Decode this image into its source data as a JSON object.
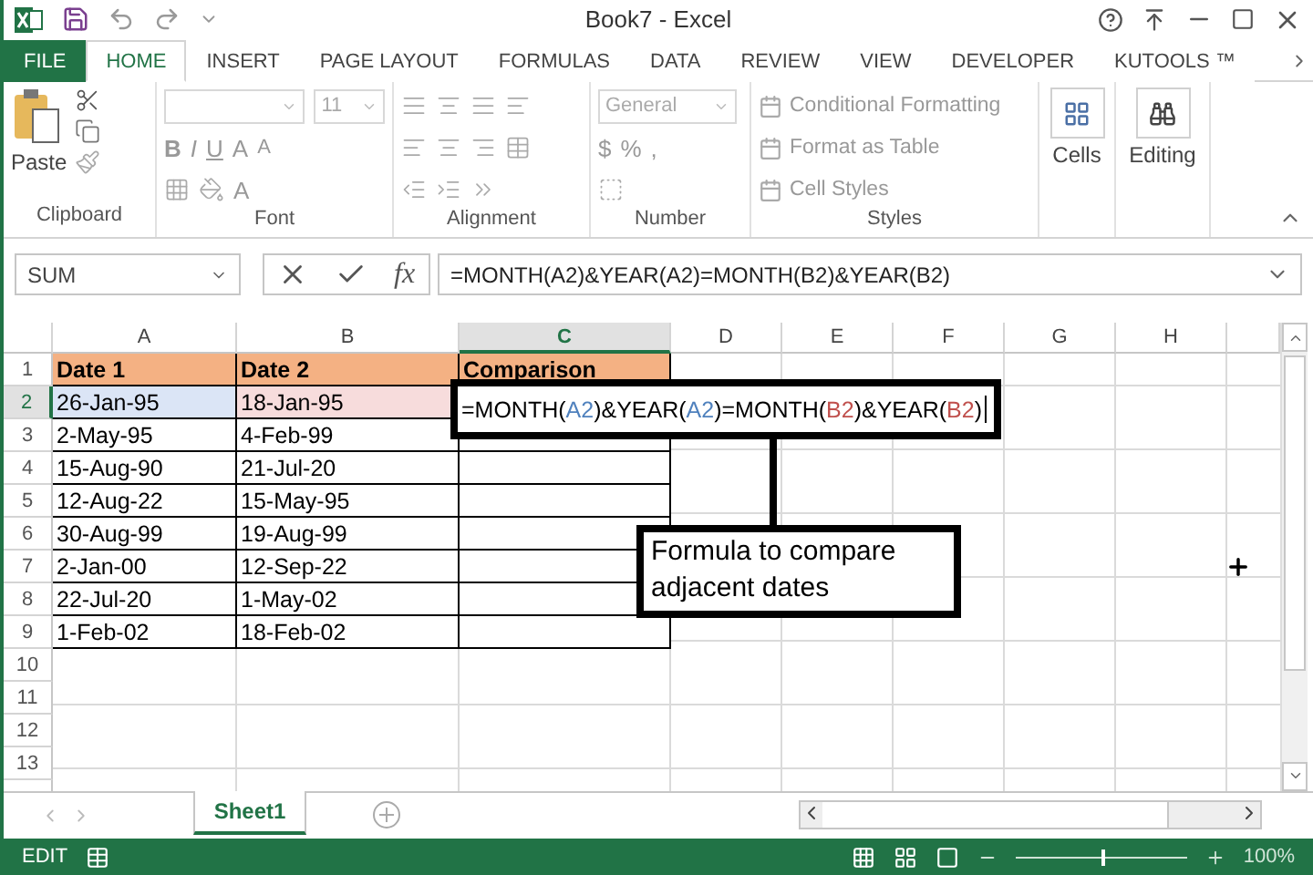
{
  "window": {
    "title": "Book7 - Excel"
  },
  "tabs": [
    {
      "label": "FILE",
      "kind": "file",
      "selected": false
    },
    {
      "label": "HOME",
      "kind": "tab",
      "selected": true
    },
    {
      "label": "INSERT",
      "kind": "tab",
      "selected": false
    },
    {
      "label": "PAGE LAYOUT",
      "kind": "tab",
      "selected": false
    },
    {
      "label": "FORMULAS",
      "kind": "tab",
      "selected": false
    },
    {
      "label": "DATA",
      "kind": "tab",
      "selected": false
    },
    {
      "label": "REVIEW",
      "kind": "tab",
      "selected": false
    },
    {
      "label": "VIEW",
      "kind": "tab",
      "selected": false
    },
    {
      "label": "DEVELOPER",
      "kind": "tab",
      "selected": false
    },
    {
      "label": "KUTOOLS ™",
      "kind": "tab",
      "selected": false
    }
  ],
  "ribbon": {
    "clipboard": {
      "label": "Clipboard",
      "paste": "Paste"
    },
    "font": {
      "label": "Font",
      "size": "11",
      "bold": "B",
      "italic": "I",
      "underline": "U",
      "grow": "A",
      "shrink": "A",
      "font_color": "A"
    },
    "alignment": {
      "label": "Alignment"
    },
    "number": {
      "label": "Number",
      "format": "General",
      "currency": "$",
      "percent": "%",
      "comma": ","
    },
    "styles": {
      "label": "Styles",
      "items": [
        "Conditional Formatting",
        "Format as Table",
        "Cell Styles"
      ]
    },
    "cells": "Cells",
    "editing": "Editing"
  },
  "name_box": "SUM",
  "function_label": "fx",
  "formula_bar": "=MONTH(A2)&YEAR(A2)=MONTH(B2)&YEAR(B2)",
  "cell_editor": [
    {
      "text": "=MONTH("
    },
    {
      "text": "A2",
      "color": "#4f81bd"
    },
    {
      "text": ")&YEAR("
    },
    {
      "text": "A2",
      "color": "#4f81bd"
    },
    {
      "text": ")=MONTH("
    },
    {
      "text": "B2",
      "color": "#c0504d"
    },
    {
      "text": ")&YEAR("
    },
    {
      "text": "B2",
      "color": "#c0504d"
    },
    {
      "text": ")"
    }
  ],
  "columns": [
    {
      "label": "A",
      "selected": false
    },
    {
      "label": "B",
      "selected": false
    },
    {
      "label": "C",
      "selected": true
    },
    {
      "label": "D",
      "selected": false
    },
    {
      "label": "E",
      "selected": false
    },
    {
      "label": "F",
      "selected": false
    },
    {
      "label": "G",
      "selected": false
    },
    {
      "label": "H",
      "selected": false
    }
  ],
  "rows": [
    {
      "number": "1",
      "selected": false,
      "kind": "header",
      "cells": [
        {
          "text": "Date 1"
        },
        {
          "text": "Date 2"
        },
        {
          "text": "Comparison"
        }
      ]
    },
    {
      "number": "2",
      "selected": true,
      "kind": "data",
      "cells": [
        {
          "text": "26-Jan-95",
          "color": "#dbe5f6"
        },
        {
          "text": "18-Jan-95",
          "color": "#f7dcdc"
        }
      ]
    },
    {
      "number": "3",
      "selected": false,
      "kind": "data",
      "cells": [
        {
          "text": "2-May-95"
        },
        {
          "text": "4-Feb-99"
        }
      ]
    },
    {
      "number": "4",
      "selected": false,
      "kind": "data",
      "cells": [
        {
          "text": "15-Aug-90"
        },
        {
          "text": "21-Jul-20"
        }
      ]
    },
    {
      "number": "5",
      "selected": false,
      "kind": "data",
      "cells": [
        {
          "text": "12-Aug-22"
        },
        {
          "text": "15-May-95"
        }
      ]
    },
    {
      "number": "6",
      "selected": false,
      "kind": "data",
      "cells": [
        {
          "text": "30-Aug-99"
        },
        {
          "text": "19-Aug-99"
        }
      ]
    },
    {
      "number": "7",
      "selected": false,
      "kind": "data",
      "cells": [
        {
          "text": "2-Jan-00"
        },
        {
          "text": "12-Sep-22"
        }
      ]
    },
    {
      "number": "8",
      "selected": false,
      "kind": "data",
      "cells": [
        {
          "text": "22-Jul-20"
        },
        {
          "text": "1-May-02"
        }
      ]
    },
    {
      "number": "9",
      "selected": false,
      "kind": "data",
      "cells": [
        {
          "text": "1-Feb-02"
        },
        {
          "text": "18-Feb-02"
        }
      ]
    },
    {
      "number": "10",
      "selected": false,
      "kind": "empty",
      "cells": []
    },
    {
      "number": "11",
      "selected": false,
      "kind": "empty",
      "cells": []
    },
    {
      "number": "12",
      "selected": false,
      "kind": "empty",
      "cells": []
    },
    {
      "number": "13",
      "selected": false,
      "kind": "empty",
      "cells": []
    }
  ],
  "callout": "Formula to compare adjacent dates",
  "sheet_tabs": [
    {
      "label": "Sheet1",
      "selected": true
    }
  ],
  "status_bar": {
    "mode": "EDIT",
    "zoom": "100%",
    "level": 0.5
  }
}
